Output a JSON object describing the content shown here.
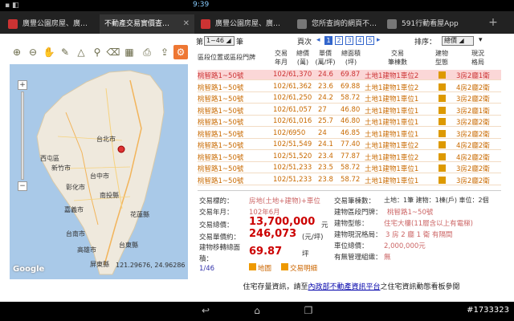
{
  "status": {
    "time": "9:39",
    "left": "▪ ◧"
  },
  "tabs": [
    {
      "label": "廣豐公園房屋、廣…",
      "icon_color": "#c33"
    },
    {
      "label": "不動產交易實價查…",
      "icon_color": "#c33"
    },
    {
      "label": "廣豐公園房屋、廣…",
      "icon_color": "#c33"
    },
    {
      "label": "您所查詢的網頁不…",
      "icon_color": "#777"
    },
    {
      "label": "591行動看屋App",
      "icon_color": "#777"
    }
  ],
  "pager": {
    "prefix": "第",
    "select": "1~46",
    "suffix": "筆",
    "pages_label": "頁次",
    "pages": [
      "1",
      "2",
      "3",
      "4",
      "5"
    ],
    "current": "1",
    "sort_label": "排序：",
    "sort_value": "總價"
  },
  "columns": {
    "c1": "區段位置或區段門牌",
    "c2a": "交易",
    "c2b": "年月",
    "c3a": "總價",
    "c3b": "(萬)",
    "c4a": "單價",
    "c4b": "(萬/坪)",
    "c5a": "總面積",
    "c5b": "(坪)",
    "c6a": "交易",
    "c6b": "筆棟數",
    "c7a": "建物",
    "c7b": "型態",
    "c8a": "現況",
    "c8b": "格局"
  },
  "rows": [
    {
      "addr": "桃智路1~50號",
      "date": "102/6",
      "total": "1,370",
      "unit": "24.6",
      "area": "69.87",
      "count": "土地1建物1車位2",
      "layout": "3房2廳1衛",
      "hl": true
    },
    {
      "addr": "桃智路1~50號",
      "date": "102/6",
      "total": "1,362",
      "unit": "23.6",
      "area": "69.88",
      "count": "土地1建物1車位2",
      "layout": "4房2廳2衛",
      "hl": false
    },
    {
      "addr": "桃智路1~50號",
      "date": "102/6",
      "total": "1,250",
      "unit": "24.2",
      "area": "58.72",
      "count": "土地1建物1車位1",
      "layout": "3房2廳2衛",
      "hl": false
    },
    {
      "addr": "桃智路1~50號",
      "date": "102/6",
      "total": "1,057",
      "unit": "27",
      "area": "46.80",
      "count": "土地1建物1車位1",
      "layout": "3房2廳1衛",
      "hl": false
    },
    {
      "addr": "桃智路1~50號",
      "date": "102/6",
      "total": "1,016",
      "unit": "25.7",
      "area": "46.80",
      "count": "土地1建物1車位1",
      "layout": "3房2廳2衛",
      "hl": false
    },
    {
      "addr": "桃智路1~50號",
      "date": "102/6",
      "total": "950",
      "unit": "24",
      "area": "46.85",
      "count": "土地1建物1車位1",
      "layout": "3房2廳2衛",
      "hl": false
    },
    {
      "addr": "桃智路1~50號",
      "date": "102/5",
      "total": "1,549",
      "unit": "24.1",
      "area": "77.40",
      "count": "土地1建物1車位2",
      "layout": "4房2廳2衛",
      "hl": false
    },
    {
      "addr": "桃智路1~50號",
      "date": "102/5",
      "total": "1,520",
      "unit": "23.4",
      "area": "77.87",
      "count": "土地1建物1車位2",
      "layout": "4房2廳2衛",
      "hl": false
    },
    {
      "addr": "桃智路1~50號",
      "date": "102/5",
      "total": "1,233",
      "unit": "23.5",
      "area": "58.72",
      "count": "土地1建物1車位1",
      "layout": "3房2廳2衛",
      "hl": false
    },
    {
      "addr": "桃智路1~50號",
      "date": "102/5",
      "total": "1,233",
      "unit": "23.8",
      "area": "58.72",
      "count": "土地1建物1車位1",
      "layout": "3房2廳2衛",
      "hl": false
    }
  ],
  "detail": {
    "l_target": "交易標的：",
    "v_target": "房地(土地+建物)+車位",
    "l_date": "交易年月：",
    "v_date": "102年6月",
    "l_total": "交易總價：",
    "v_total": "13,700,000",
    "u_total": "元",
    "l_unit": "交易單價約：",
    "v_unit": "246,073",
    "u_unit": "(元/坪)",
    "l_area1": "建物移轉總面",
    "l_area2": "積：",
    "v_area": "69.87",
    "u_area": "坪",
    "pageinfo": "1/46",
    "btn_map": "地圖",
    "btn_detail": "交易明細",
    "r_count_l": "交易筆棟數：",
    "r_count_v": "土地：1筆 建物：1棟(戶) 車位：2個",
    "r_addr_l": "建物區段門牌：",
    "r_addr_v": "桃智路1~50號",
    "r_type_l": "建物型態：",
    "r_type_v": "住宅大樓(11層含以上有電梯)",
    "r_layout_l": "建物現況格局：",
    "r_layout_v": "3 房 2 廳 1 衛 有隔間",
    "r_park_l": "車位總價：",
    "r_park_v": "2,000,000元",
    "r_org_l": "有無管理組織：",
    "r_org_v": "無"
  },
  "footer": {
    "pre": "住宅存量資訊，請至",
    "link": "內政部不動產資訊平台",
    "post": "之住宅資訊動態看板參閱"
  },
  "map": {
    "coord": "121.29676, 24.96286",
    "google": "Google",
    "labels": [
      "台北市",
      "新竹市",
      "台中市",
      "彰化市",
      "南投縣",
      "嘉義市",
      "台南市",
      "高雄市",
      "花蓮縣",
      "台東縣",
      "屏東縣",
      "西屯區"
    ]
  },
  "watermark": "#1733323"
}
